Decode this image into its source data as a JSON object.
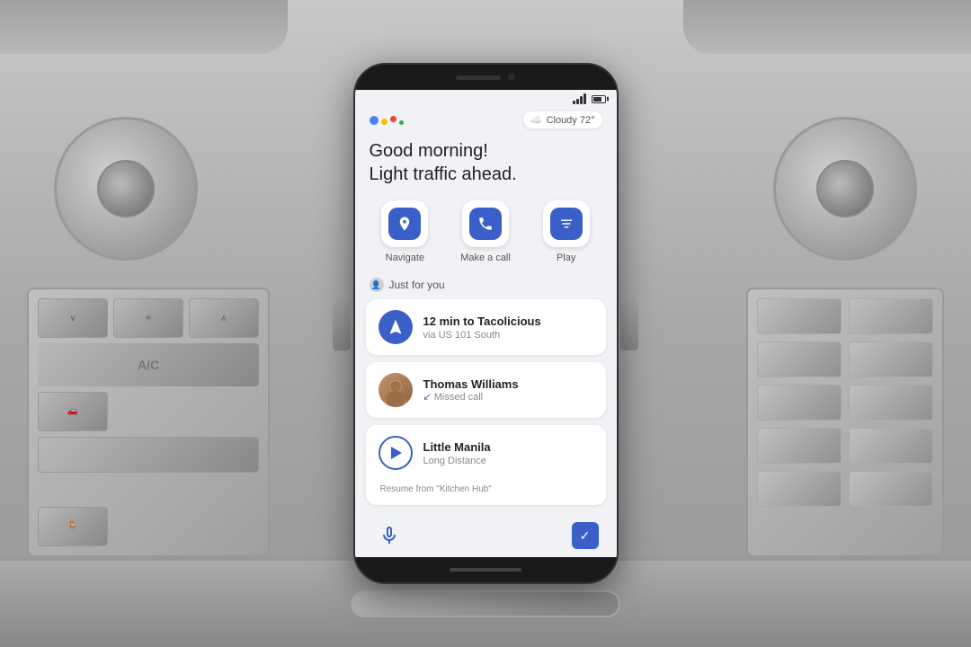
{
  "background": {
    "color": "#b0b0b0"
  },
  "status_bar": {
    "signal": "signal",
    "battery": "battery"
  },
  "header": {
    "assistant_icon": "google-assistant",
    "weather_icon": "☁️",
    "weather_temp": "Cloudy 72°"
  },
  "greeting": {
    "line1": "Good morning!",
    "line2": "Light traffic ahead."
  },
  "quick_actions": [
    {
      "label": "Navigate",
      "icon": "📍"
    },
    {
      "label": "Make a call",
      "icon": "📞"
    },
    {
      "label": "Play",
      "icon": "▶"
    }
  ],
  "just_for_you": {
    "label": "Just for you"
  },
  "cards": [
    {
      "type": "navigation",
      "title": "12 min to Tacolicious",
      "subtitle": "via US 101 South",
      "icon": "▲"
    },
    {
      "type": "contact",
      "name": "Thomas Williams",
      "subtitle": "Missed call"
    },
    {
      "type": "music",
      "title": "Little Manila",
      "subtitle": "Long Distance",
      "resume_text": "Resume from \"Kitchen Hub\""
    }
  ],
  "bottom_bar": {
    "mic_label": "mic",
    "check_label": "✓"
  }
}
